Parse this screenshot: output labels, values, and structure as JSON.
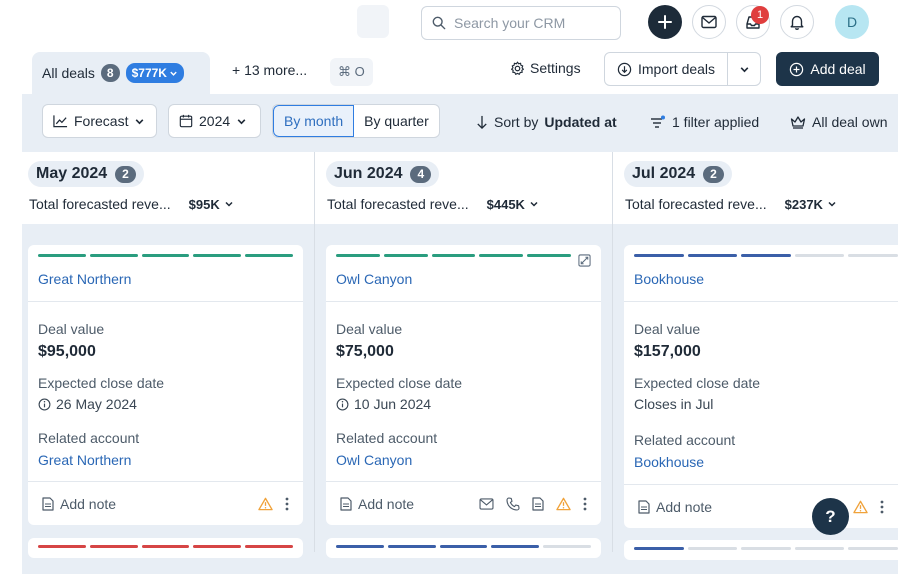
{
  "search": {
    "placeholder": "Search your CRM"
  },
  "header": {
    "notification_count": "1",
    "avatar_initial": "D"
  },
  "tabs": {
    "active_label": "All deals",
    "active_count": "8",
    "active_amount": "$777K",
    "more_label": "+ 13 more...",
    "shortcut": "⌘ O",
    "settings_label": "Settings",
    "import_label": "Import deals",
    "add_label": "Add deal"
  },
  "toolbar": {
    "forecast_label": "Forecast",
    "year_label": "2024",
    "by_month": "By month",
    "by_quarter": "By quarter",
    "sort_prefix": "Sort by",
    "sort_field": "Updated at",
    "filter_label": "1 filter applied",
    "owner_label": "All deal own"
  },
  "columns": [
    {
      "month": "May 2024",
      "count": "2",
      "forecast_label": "Total forecasted reve...",
      "forecast_value": "$95K",
      "card": {
        "title": "Great Northern",
        "value_label": "Deal value",
        "value": "$95,000",
        "close_label": "Expected close date",
        "close_value": "26 May 2024",
        "account_label": "Related account",
        "account": "Great Northern",
        "note_label": "Add note"
      }
    },
    {
      "month": "Jun 2024",
      "count": "4",
      "forecast_label": "Total forecasted reve...",
      "forecast_value": "$445K",
      "card": {
        "title": "Owl Canyon",
        "value_label": "Deal value",
        "value": "$75,000",
        "close_label": "Expected close date",
        "close_value": "10 Jun 2024",
        "account_label": "Related account",
        "account": "Owl Canyon",
        "note_label": "Add note"
      }
    },
    {
      "month": "Jul 2024",
      "count": "2",
      "forecast_label": "Total forecasted reve...",
      "forecast_value": "$237K",
      "card": {
        "title": "Bookhouse",
        "value_label": "Deal value",
        "value": "$157,000",
        "close_label": "Expected close date",
        "close_value": "Closes in Jul",
        "account_label": "Related account",
        "account": "Bookhouse",
        "note_label": "Add note"
      }
    }
  ],
  "help": {
    "label": "?"
  },
  "colors": {
    "accent": "#2f7de1",
    "dark": "#1d3449",
    "stage_green": "#2a9d7f",
    "stage_blue": "#3b5fa8",
    "stage_red": "#d64545",
    "stage_empty": "#d9dee4",
    "warning": "#f0a23a"
  }
}
